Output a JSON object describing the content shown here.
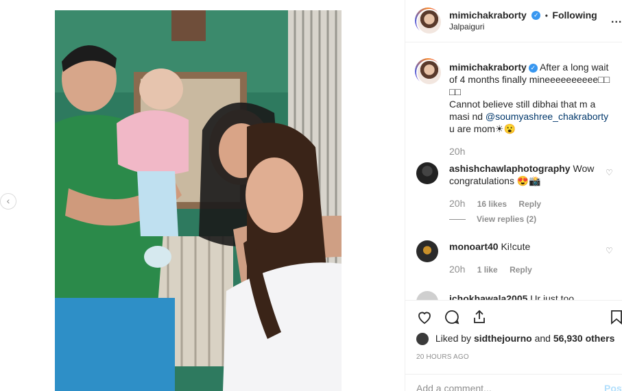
{
  "navigation": {
    "prev_icon": "chevron-left-icon",
    "prev_symbol": "‹"
  },
  "post_header": {
    "username": "mimichakraborty",
    "verified_mark": "✓",
    "separator": "•",
    "following_label": "Following",
    "location": "Jalpaiguri",
    "more_label": "..."
  },
  "caption": {
    "username": "mimichakraborty",
    "text_before": "After a long wait of 4 months finally mineeeeeeeeee□□\n□□\nCannot believe still dibhai that m a masi nd ",
    "mention": "@soumyashree_chakraborty",
    "text_after": " u are mom☀😮",
    "time": "20h"
  },
  "comments": [
    {
      "username": "ashishchawlaphotography",
      "text": "Wow congratulations 😍📸",
      "time": "20h",
      "likes": "16 likes",
      "reply_label": "Reply",
      "view_replies": "View replies (2)"
    },
    {
      "username": "monoart40",
      "text": "Ki!cute",
      "time": "20h",
      "likes": "1 like",
      "reply_label": "Reply"
    },
    {
      "username": "ichokhawala2005",
      "text": "Ur just too"
    }
  ],
  "likes": {
    "prefix": "Liked by",
    "user": "sidthejourno",
    "and_word": "and",
    "others": "56,930 others"
  },
  "timestamp": "20 HOURS AGO",
  "comment_input": {
    "placeholder": "Add a comment...",
    "post_label": "Post"
  },
  "colors": {
    "accent": "#3897f0",
    "link": "#00376b",
    "muted": "#8e8e8e",
    "post_disabled": "#b2dffc"
  }
}
